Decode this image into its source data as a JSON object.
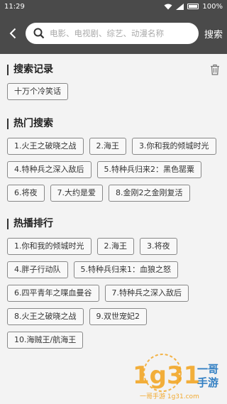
{
  "status": {
    "time": "11:29",
    "battery": "100%"
  },
  "search": {
    "placeholder": "电影、电视剧、综艺、动漫名称",
    "value": "",
    "button_label": "搜索"
  },
  "history": {
    "title": "搜索记录",
    "items": [
      "十万个冷笑话"
    ]
  },
  "hot": {
    "title": "热门搜索",
    "items": [
      "1.火王之破晓之战",
      "2.海王",
      "3.你和我的倾城时光",
      "4.特种兵之深入敌后",
      "5.特种兵归来2：黑色罂粟",
      "6.将夜",
      "7.大约是爱",
      "8.金刚2之金刚复活"
    ]
  },
  "ranking": {
    "title": "热播排行",
    "items": [
      "1.你和我的倾城时光",
      "2.海王",
      "3.将夜",
      "4.胖子行动队",
      "5.特种兵归来1：血狼之怒",
      "6.四平青年之喋血曼谷",
      "7.特种兵之深入敌后",
      "8.火王之破晓之战",
      "9.双世宠妃2",
      "10.海贼王/航海王"
    ]
  },
  "watermark": {
    "logo_text": "1g31",
    "brand": "一哥手游",
    "url": "一哥手游 1g31.com"
  },
  "colors": {
    "header": "#4a4a4a",
    "background": "#f3f3f3",
    "tag_border": "#888888",
    "watermark_orange": "#f2a21a",
    "watermark_blue": "#1e73be"
  }
}
